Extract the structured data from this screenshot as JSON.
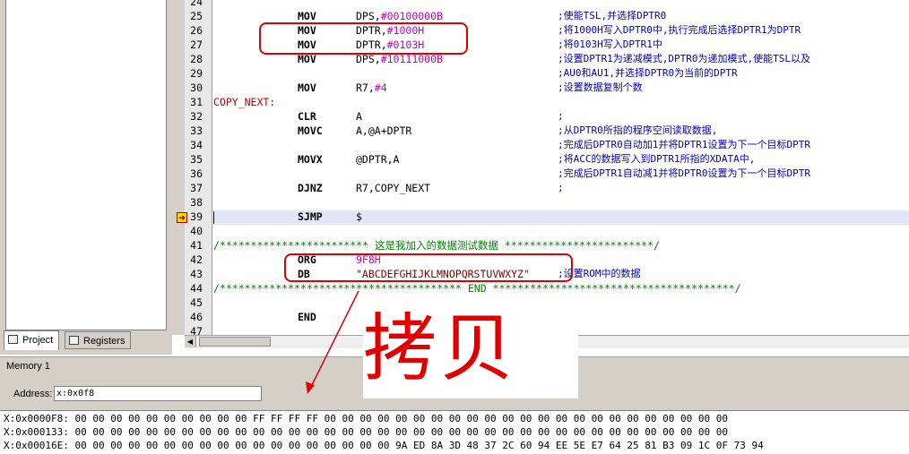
{
  "code_lines": [
    {
      "n": "24",
      "label": "",
      "op": "",
      "args": "",
      "comment": ""
    },
    {
      "n": "25",
      "label": "",
      "op": "MOV",
      "args": "DPS,#00100000B",
      "comment": ";使能TSL,并选择DPTR0"
    },
    {
      "n": "26",
      "label": "",
      "op": "MOV",
      "args": "DPTR,#1000H",
      "comment": ";将1000H写入DPTR0中,执行完成后选择DPTR1为DPTR"
    },
    {
      "n": "27",
      "label": "",
      "op": "MOV",
      "args": "DPTR,#0103H",
      "comment": ";将0103H写入DPTR1中"
    },
    {
      "n": "28",
      "label": "",
      "op": "MOV",
      "args": "DPS,#10111000B",
      "comment": ";设置DPTR1为递减模式,DPTR0为递加模式,使能TSL以及"
    },
    {
      "n": "29",
      "label": "",
      "op": "",
      "args": "",
      "comment": ";AU0和AU1,并选择DPTR0为当前的DPTR"
    },
    {
      "n": "30",
      "label": "",
      "op": "MOV",
      "args": "R7,#4",
      "comment": ";设置数据复制个数"
    },
    {
      "n": "31",
      "label": "COPY_NEXT:",
      "op": "",
      "args": "",
      "comment": ""
    },
    {
      "n": "32",
      "label": "",
      "op": "CLR",
      "args": "A",
      "comment": ";"
    },
    {
      "n": "33",
      "label": "",
      "op": "MOVC",
      "args": "A,@A+DPTR",
      "comment": ";从DPTR0所指的程序空间读取数据,"
    },
    {
      "n": "34",
      "label": "",
      "op": "",
      "args": "",
      "comment": ";完成后DPTR0自动加1并将DPTR1设置为下一个目标DPTR"
    },
    {
      "n": "35",
      "label": "",
      "op": "MOVX",
      "args": "@DPTR,A",
      "comment": ";将ACC的数据写入到DPTR1所指的XDATA中,"
    },
    {
      "n": "36",
      "label": "",
      "op": "",
      "args": "",
      "comment": ";完成后DPTR1自动减1并将DPTR0设置为下一个目标DPTR"
    },
    {
      "n": "37",
      "label": "",
      "op": "DJNZ",
      "args": "R7,COPY_NEXT",
      "comment": ";"
    },
    {
      "n": "38",
      "label": "",
      "op": "",
      "args": "",
      "comment": ""
    },
    {
      "n": "39",
      "label": "",
      "op": "SJMP",
      "args": "$",
      "comment": ""
    },
    {
      "n": "40",
      "label": "",
      "op": "",
      "args": "",
      "comment": ""
    },
    {
      "n": "41",
      "label": "",
      "op": "",
      "args": "",
      "comment": "",
      "banner": "/************************ 这是我加入的数据测试数据 ************************/"
    },
    {
      "n": "42",
      "label": "",
      "op": "ORG",
      "args": "9F8H",
      "comment": ""
    },
    {
      "n": "43",
      "label": "",
      "op": "DB",
      "args": "\"ABCDEFGHIJKLMNOPQRSTUVWXYZ\"",
      "comment": ";设置ROM中的数据"
    },
    {
      "n": "44",
      "label": "",
      "op": "",
      "args": "",
      "comment": "",
      "banner": "/*************************************** END ***************************************/"
    },
    {
      "n": "45",
      "label": "",
      "op": "",
      "args": "",
      "comment": ""
    },
    {
      "n": "46",
      "label": "",
      "op": "END",
      "args": "",
      "comment": ""
    },
    {
      "n": "47",
      "label": "",
      "op": "",
      "args": "",
      "comment": ""
    }
  ],
  "tabs": {
    "project": "Project",
    "registers": "Registers"
  },
  "memory": {
    "title": "Memory 1",
    "address_label": "Address:",
    "address_value": "x:0x0f8",
    "rows": [
      "X:0x0000F8: 00 00 00 00 00 00 00 00 00 00 FF FF FF FF 00 00 00 00 00 00 00 00 00 00 00 00 00 00 00 00 00 00 00 00 00 00 00",
      "X:0x000133: 00 00 00 00 00 00 00 00 00 00 00 00 00 00 00 00 00 00 00 00 00 00 00 00 00 00 00 00 00 00 00 00 00 00 00 00 00",
      "X:0x00016E: 00 00 00 00 00 00 00 00 00 00 00 00 00 00 00 00 00 00 9A ED 8A 3D 48 37 2C 60 94 EE 5E E7 64 25 81 B3 09 1C 0F 73 94"
    ]
  },
  "annotation": {
    "text": "拷贝",
    "color": "#e00000"
  },
  "colors": {
    "highlight_box": "#e00000",
    "comment": "#0000c0",
    "label": "#c00000",
    "banner": "#008000",
    "current_line": "#e2e6f6"
  }
}
